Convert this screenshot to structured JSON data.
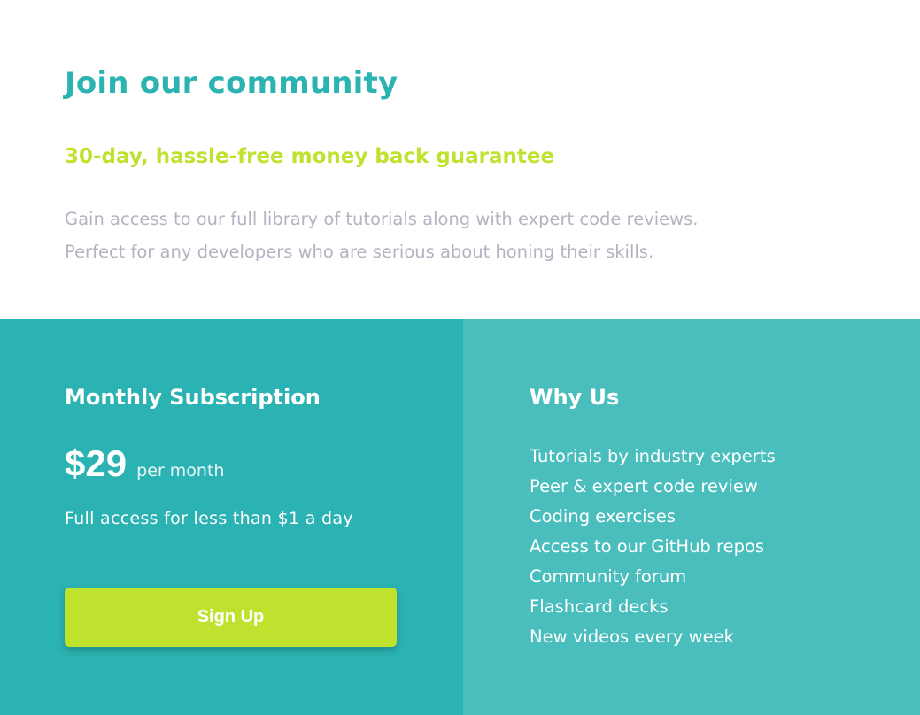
{
  "header": {
    "title": "Join our community",
    "subtitle": "30-day, hassle-free money back guarantee",
    "description_lines": [
      "Gain access to our full library of tutorials along with expert code reviews.",
      "Perfect for any developers who are serious about honing their skills."
    ]
  },
  "subscription": {
    "title": "Monthly Subscription",
    "price": "$29",
    "period": "per month",
    "tagline": "Full access for less than $1 a day",
    "button_label": "Sign Up"
  },
  "why_us": {
    "title": "Why Us",
    "items": [
      "Tutorials by industry experts",
      "Peer & expert code review",
      "Coding exercises",
      "Access to our GitHub repos",
      "Community forum",
      "Flashcard decks",
      "New videos every week"
    ]
  },
  "colors": {
    "accent_cyan": "#2bb3b1",
    "accent_lime": "#bfe22f",
    "panel_left": "#2bb2b2",
    "panel_right": "#4abebd",
    "muted_text": "#b3b4c2"
  }
}
